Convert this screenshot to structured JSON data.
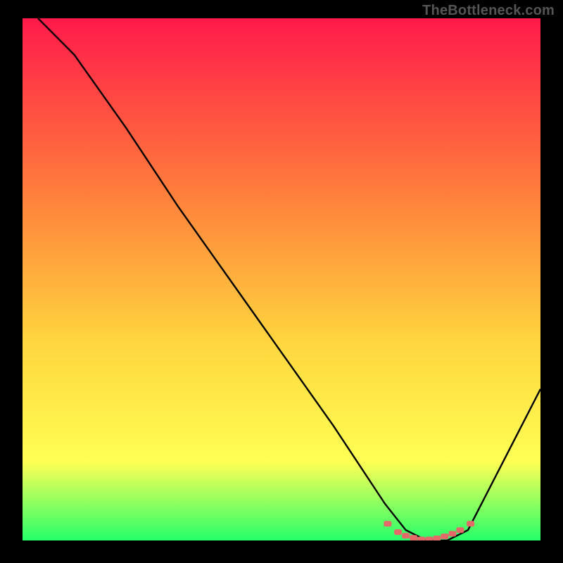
{
  "watermark": "TheBottleneck.com",
  "colors": {
    "background": "#000000",
    "gradient_top": "#ff1a4a",
    "gradient_mid1": "#ff7a3c",
    "gradient_mid2": "#ffd63e",
    "gradient_mid3": "#ffff55",
    "gradient_bottom": "#26ff6a",
    "curve": "#000000",
    "marker": "#e46a6a"
  },
  "chart_data": {
    "type": "line",
    "title": "",
    "xlabel": "",
    "ylabel": "",
    "xlim": [
      0,
      100
    ],
    "ylim": [
      0,
      100
    ],
    "series": [
      {
        "name": "bottleneck-curve",
        "x": [
          3,
          10,
          20,
          30,
          40,
          50,
          60,
          70,
          74,
          78,
          82,
          86,
          100
        ],
        "y": [
          100,
          93,
          79,
          64,
          50,
          36,
          22,
          7,
          2,
          0,
          0,
          2,
          29
        ]
      }
    ],
    "markers": {
      "name": "optimal-zone",
      "x": [
        70.5,
        72.5,
        74,
        75.5,
        77,
        78.5,
        80,
        81.5,
        83,
        84.5,
        86.5
      ],
      "y": [
        3.2,
        1.6,
        0.9,
        0.5,
        0.2,
        0.2,
        0.4,
        0.8,
        1.3,
        2.0,
        3.2
      ]
    }
  }
}
